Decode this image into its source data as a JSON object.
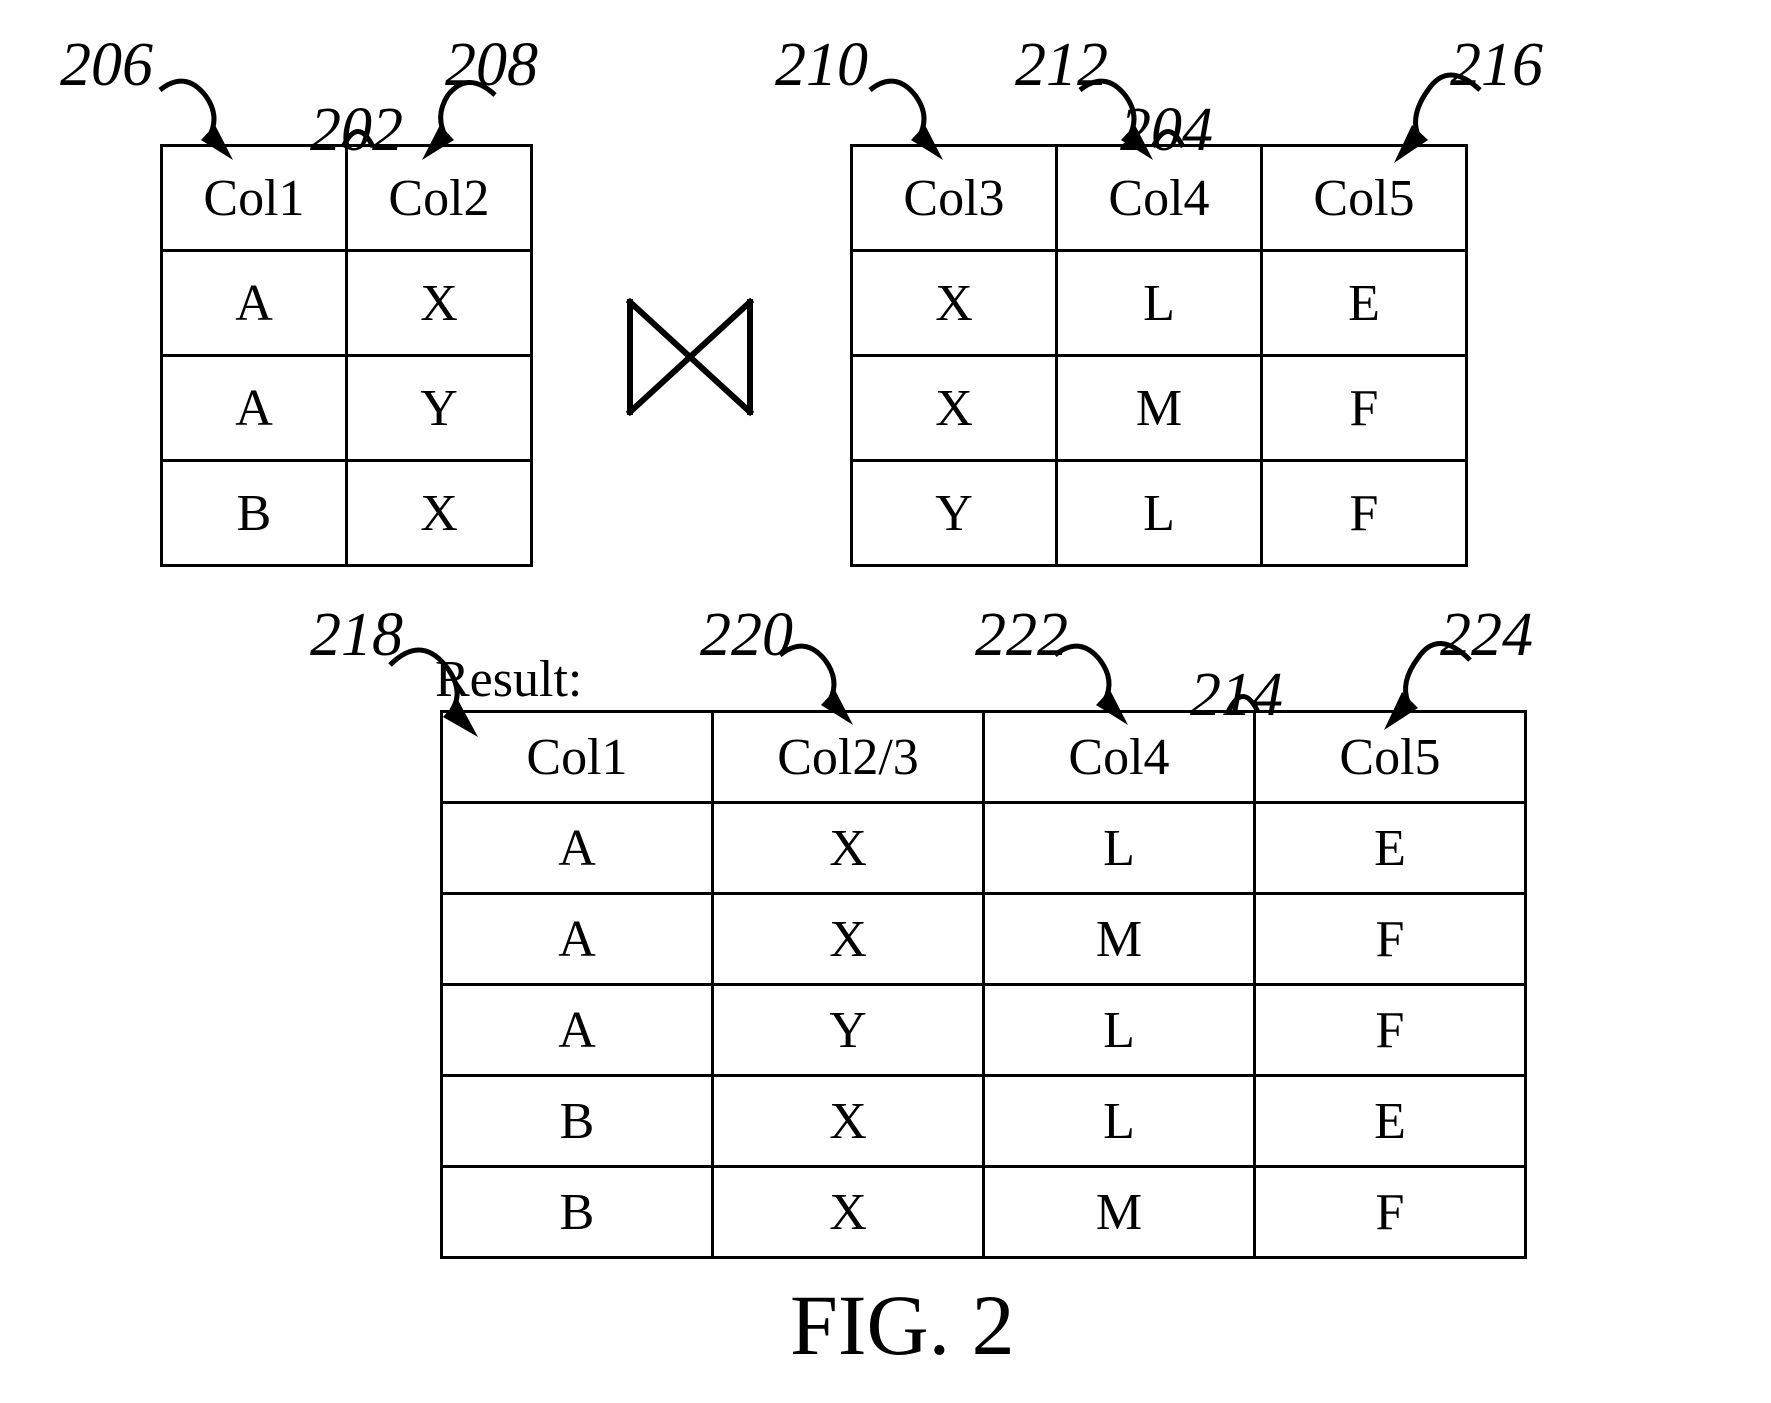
{
  "table1": {
    "ref_label": "202",
    "cols": [
      {
        "header": "Col1",
        "ref": "206",
        "values": [
          "A",
          "A",
          "B"
        ]
      },
      {
        "header": "Col2",
        "ref": "208",
        "values": [
          "X",
          "Y",
          "X"
        ]
      }
    ]
  },
  "table2": {
    "ref_label": "204",
    "cols": [
      {
        "header": "Col3",
        "ref": "210",
        "values": [
          "X",
          "X",
          "Y"
        ]
      },
      {
        "header": "Col4",
        "ref": "212",
        "values": [
          "L",
          "M",
          "L"
        ]
      },
      {
        "header": "Col5",
        "ref": "216",
        "values": [
          "E",
          "F",
          "F"
        ]
      }
    ]
  },
  "result": {
    "label": "Result:",
    "ref_label": "214",
    "cols": [
      {
        "header": "Col1",
        "ref": "218",
        "values": [
          "A",
          "A",
          "A",
          "B",
          "B"
        ]
      },
      {
        "header": "Col2/3",
        "ref": "220",
        "values": [
          "X",
          "X",
          "Y",
          "X",
          "X"
        ]
      },
      {
        "header": "Col4",
        "ref": "222",
        "values": [
          "L",
          "M",
          "L",
          "L",
          "M"
        ]
      },
      {
        "header": "Col5",
        "ref": "224",
        "values": [
          "E",
          "F",
          "F",
          "E",
          "F"
        ]
      }
    ]
  },
  "join_symbol": "⋈",
  "figure_caption": "FIG. 2"
}
